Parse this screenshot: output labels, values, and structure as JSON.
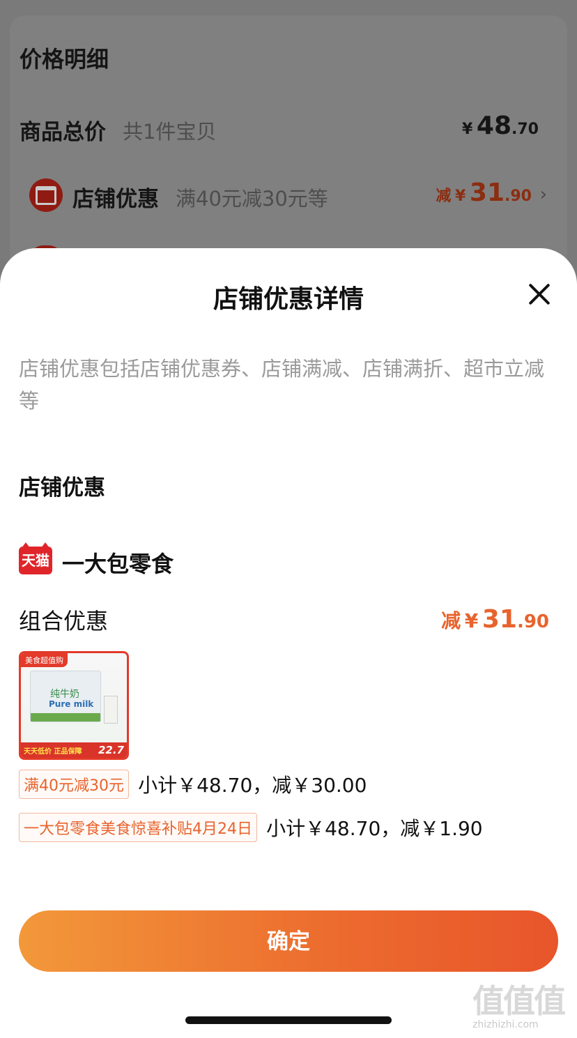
{
  "background": {
    "title": "价格明细",
    "total_row": {
      "label": "商品总价",
      "sub": "共1件宝贝",
      "yen": "¥",
      "amount_int": "48",
      "amount_dec": ".70"
    },
    "store_row": {
      "label": "店铺优惠",
      "sub": "满40元减30元等",
      "prefix": "减",
      "yen": "¥",
      "amount_int": "31",
      "amount_dec": ".90"
    }
  },
  "sheet": {
    "title": "店铺优惠详情",
    "description": "店铺优惠包括店铺优惠券、店铺满减、店铺满折、超市立减等",
    "section_title": "店铺优惠",
    "shop": {
      "logo_text": "天猫",
      "name": "一大包零食"
    },
    "combo": {
      "title": "组合优惠",
      "prefix": "减",
      "yen": "¥",
      "amount_int": "31",
      "amount_dec": ".90"
    },
    "product": {
      "tag": "美食超值购",
      "box_text": "纯牛奶",
      "box_text_en": "Pure milk",
      "strip_text": "天天低价 正品保障",
      "price": "22.7"
    },
    "promos": [
      {
        "chip": "满40元减30元",
        "text": "小计￥48.70，减￥30.00"
      },
      {
        "chip": "一大包零食美食惊喜补贴4月24日",
        "text": "小计￥48.70，减￥1.90"
      }
    ],
    "confirm_label": "确定"
  },
  "watermark": {
    "chars": "值值值",
    "url": "zhizhizhi.com"
  },
  "colors": {
    "accent": "#e8632d",
    "brand_red": "#e0252a"
  },
  "icons": [
    "store-icon",
    "close-icon",
    "chevron-right-icon",
    "tmall-logo-icon"
  ]
}
